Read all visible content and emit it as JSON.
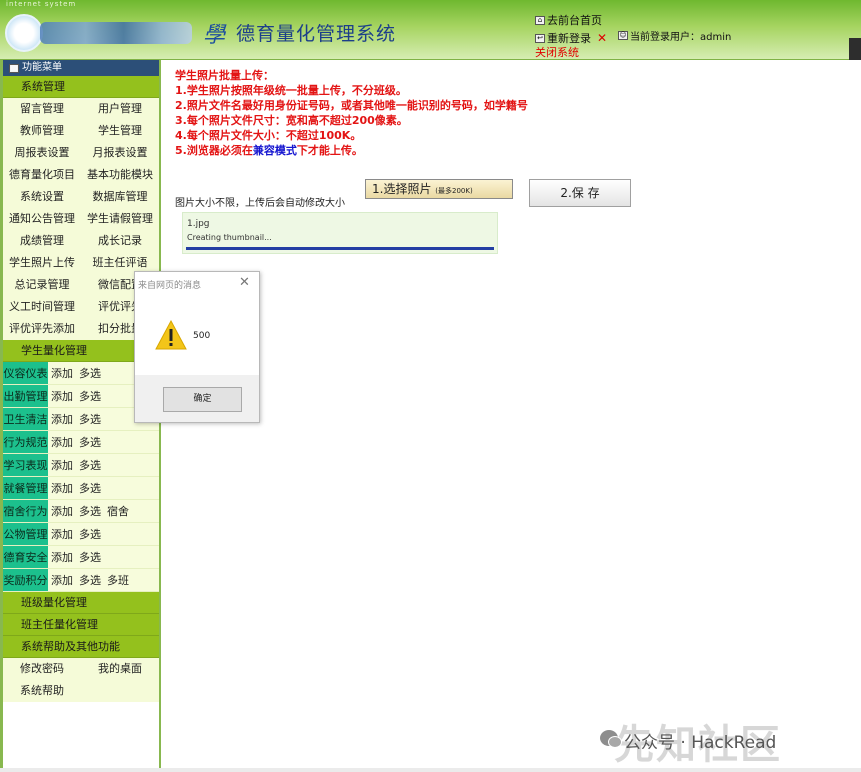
{
  "header": {
    "topline": "internet system",
    "logo_char": "學",
    "title": "德育量化管理系统",
    "home_link": "去前台首页",
    "relogin_link": "重新登录",
    "exit_link": "关闭系统",
    "current_user": "当前登录用户：admin"
  },
  "sidebar": {
    "menu_title": "功能菜单",
    "system_section": "系统管理",
    "system_items": [
      [
        "留言管理",
        "用户管理"
      ],
      [
        "教师管理",
        "学生管理"
      ],
      [
        "周报表设置",
        "月报表设置"
      ],
      [
        "德育量化项目",
        "基本功能模块"
      ],
      [
        "系统设置",
        "数据库管理"
      ],
      [
        "通知公告管理",
        "学生请假管理"
      ],
      [
        "成绩管理",
        "成长记录"
      ],
      [
        "学生照片上传",
        "班主任评语"
      ],
      [
        "总记录管理",
        "微信配置"
      ],
      [
        "义工时间管理",
        "评优评先"
      ],
      [
        "评优评先添加",
        "扣分批量"
      ]
    ],
    "quant_section": "学生量化管理",
    "quant_items": [
      {
        "cat": "仪容仪表",
        "actions": [
          "添加",
          "多选"
        ]
      },
      {
        "cat": "出勤管理",
        "actions": [
          "添加",
          "多选"
        ]
      },
      {
        "cat": "卫生清洁",
        "actions": [
          "添加",
          "多选"
        ]
      },
      {
        "cat": "行为规范",
        "actions": [
          "添加",
          "多选"
        ]
      },
      {
        "cat": "学习表现",
        "actions": [
          "添加",
          "多选"
        ]
      },
      {
        "cat": "就餐管理",
        "actions": [
          "添加",
          "多选"
        ]
      },
      {
        "cat": "宿舍行为",
        "actions": [
          "添加",
          "多选",
          "宿舍"
        ]
      },
      {
        "cat": "公物管理",
        "actions": [
          "添加",
          "多选"
        ]
      },
      {
        "cat": "德育安全",
        "actions": [
          "添加",
          "多选"
        ]
      },
      {
        "cat": "奖励积分",
        "actions": [
          "添加",
          "多选",
          "多班"
        ]
      }
    ],
    "class_section": "班级量化管理",
    "teacher_section": "班主任量化管理",
    "help_section": "系统帮助及其他功能",
    "help_items": [
      [
        "修改密码",
        "我的桌面"
      ],
      [
        "系统帮助",
        ""
      ]
    ]
  },
  "main": {
    "instructions": {
      "heading": "学生照片批量上传：",
      "line1": "1.学生照片按照年级统一批量上传，不分班级。",
      "line2": "2.照片文件名最好用身份证号码，或者其他唯一能识别的号码，如学籍号",
      "line3": "3.每个照片文件尺寸：宽和高不超过200像素。",
      "line4": "4.每个照片文件大小：不超过100K。",
      "line5_prefix": "5.浏览器必须在",
      "line5_mode": "兼容模式",
      "line5_suffix": "下才能上传。"
    },
    "upload_hint": "图片大小不限，上传后会自动修改大小",
    "choose_button": "1.选择照片",
    "choose_button_note": "(最多200K)",
    "save_button": "2.保 存",
    "file": {
      "name": "1.jpg",
      "status": "Creating thumbnail...",
      "progress": 1.0
    }
  },
  "alert": {
    "title": "来自网页的消息",
    "message": "500",
    "ok_button": "确定"
  },
  "watermark": {
    "big": "先知社区",
    "text": "公众号 · HackRead"
  },
  "colors": {
    "header_green": "#a6d461",
    "section_green": "#94c11d",
    "category_teal": "#1cc08d",
    "instruction_red": "#e31414",
    "progress_blue": "#233ea3"
  }
}
